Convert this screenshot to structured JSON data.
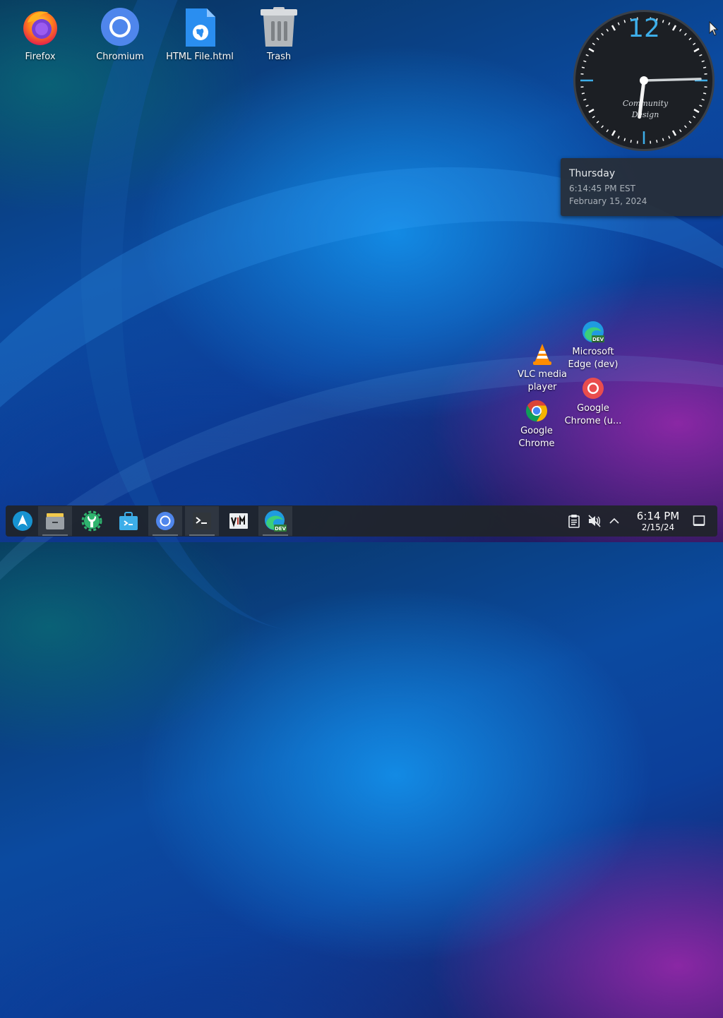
{
  "desktop": {
    "icons_top": [
      {
        "label": "Firefox",
        "icon": "firefox-icon"
      },
      {
        "label": "Chromium",
        "icon": "chromium-icon"
      },
      {
        "label": "HTML File.html",
        "icon": "html-file-icon"
      },
      {
        "label": "Trash",
        "icon": "trash-icon"
      }
    ],
    "icons_bottom": [
      {
        "label": "Microsoft Edge (dev)",
        "icon": "edge-dev-icon"
      },
      {
        "label": "VLC media player",
        "icon": "vlc-icon"
      },
      {
        "label": "Google Chrome (u...",
        "icon": "chrome-unstable-icon"
      },
      {
        "label": "Google Chrome",
        "icon": "chrome-icon"
      }
    ]
  },
  "clock_widget": {
    "numeral": "12",
    "brand_line1": "Community",
    "brand_line2": "Design",
    "hours": 6,
    "minutes": 14,
    "seconds": 45,
    "accent": "#3daee9"
  },
  "tooltip": {
    "day": "Thursday",
    "time": "6:14:45 PM EST",
    "date": "February 15, 2024"
  },
  "taskbar": {
    "apps": [
      {
        "name": "application-launcher",
        "icon": "arch-launcher-icon",
        "active": false
      },
      {
        "name": "file-manager",
        "icon": "file-manager-icon",
        "active": true
      },
      {
        "name": "system-settings",
        "icon": "settings-wrench-icon",
        "active": false
      },
      {
        "name": "discover",
        "icon": "discover-store-icon",
        "active": false
      },
      {
        "name": "chromium",
        "icon": "chromium-icon",
        "active": true
      },
      {
        "name": "konsole",
        "icon": "terminal-icon",
        "active": true
      },
      {
        "name": "vim",
        "icon": "vim-icon",
        "active": false
      },
      {
        "name": "edge-dev",
        "icon": "edge-dev-icon",
        "active": true
      }
    ],
    "tray": {
      "clipboard_icon": "clipboard-icon",
      "volume_icon": "volume-muted-icon",
      "expand_icon": "chevron-up-icon"
    },
    "clock_time": "6:14 PM",
    "clock_date": "2/15/24",
    "show_desktop_icon": "show-desktop-icon"
  }
}
